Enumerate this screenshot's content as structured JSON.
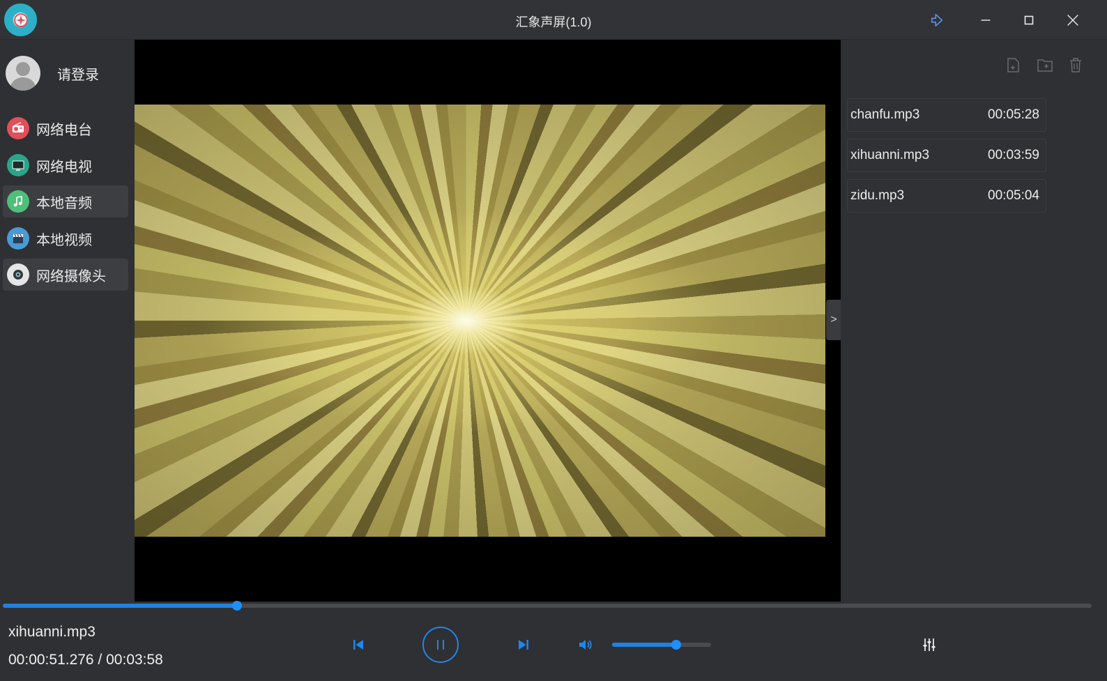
{
  "window": {
    "title": "汇象声屏(1.0)",
    "logo_icon": "app-logo-icon",
    "buttons": [
      "pin-icon",
      "minimize-icon",
      "maximize-icon",
      "close-icon"
    ]
  },
  "colors": {
    "accent": "#1e82e4",
    "background": "#2f3033",
    "video_background": "#000000"
  },
  "sidebar": {
    "login_text": "请登录",
    "items": [
      {
        "label": "网络电台",
        "icon": "radio-icon",
        "icon_color": "#e0505a",
        "active": false
      },
      {
        "label": "网络电视",
        "icon": "tv-icon",
        "icon_color": "#2aa58a",
        "active": false
      },
      {
        "label": "本地音频",
        "icon": "music-note-icon",
        "icon_color": "#4fbf7a",
        "active": true
      },
      {
        "label": "本地视频",
        "icon": "clapperboard-icon",
        "icon_color": "#4a9ad4",
        "active": false
      },
      {
        "label": "网络摄像头",
        "icon": "webcam-icon",
        "icon_color": "#e6e6e6",
        "active": true
      }
    ]
  },
  "player": {
    "collapse_label": ">"
  },
  "playlist": {
    "tools": [
      "add-file-icon",
      "add-folder-icon",
      "delete-icon"
    ],
    "items": [
      {
        "name": "chanfu.mp3",
        "duration": "00:05:28"
      },
      {
        "name": "xihuanni.mp3",
        "duration": "00:03:59"
      },
      {
        "name": "zidu.mp3",
        "duration": "00:05:04"
      }
    ]
  },
  "playback": {
    "current_title": "xihuanni.mp3",
    "time_display": "00:00:51.276 / 00:03:58",
    "progress_fraction": 0.215,
    "volume_fraction": 0.65,
    "state": "playing",
    "controls": [
      "previous-icon",
      "pause-icon",
      "next-icon",
      "volume-icon",
      "equalizer-icon"
    ]
  }
}
